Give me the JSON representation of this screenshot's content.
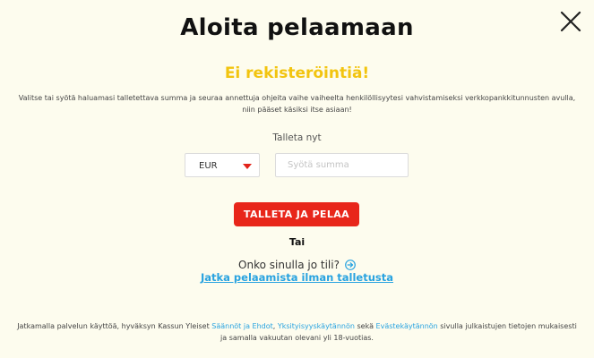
{
  "modal": {
    "title": "Aloita pelaamaan",
    "subtitle": "Ei rekisteröintiä!",
    "description": "Valitse tai syötä haluamasi talletettava summa ja seuraa annettuja ohjeita vaihe vaiheelta henkilöllisyytesi vahvistamiseksi verkkopankkitunnusten avulla, niin pääset käsiksi itse asiaan!",
    "close_icon": "close-x-icon"
  },
  "deposit": {
    "label": "Talleta nyt",
    "currency": {
      "selected": "EUR",
      "caret_color": "#e2231a"
    },
    "amount": {
      "value": "",
      "placeholder": "Syötä summa"
    },
    "cta_label": "TALLETA JA PELAA",
    "cta_color": "#e8261a"
  },
  "alternative": {
    "or_text": "Tai",
    "account_question": "Onko sinulla jo tili?",
    "account_icon": "arrow-right-circle-icon",
    "continue_link": "Jatka pelaamista ilman talletusta"
  },
  "footer": {
    "text_before": "Jatkamalla palvelun käyttöä, hyväksyn Kassun Yleiset ",
    "link_terms": "Säännöt ja Ehdot",
    "sep1": ", ",
    "link_privacy": "Yksityisyyskäytännön",
    "sep2": " sekä ",
    "link_cookies": "Evästekäytännön",
    "text_after": " sivulla julkaistujen tietojen mukaisesti ja samalla vakuutan olevani yli 18-vuotias."
  },
  "colors": {
    "background": "#fdfcee",
    "accent_yellow": "#f2c40f",
    "link_blue": "#29a3e0",
    "cta_red": "#e8261a"
  }
}
